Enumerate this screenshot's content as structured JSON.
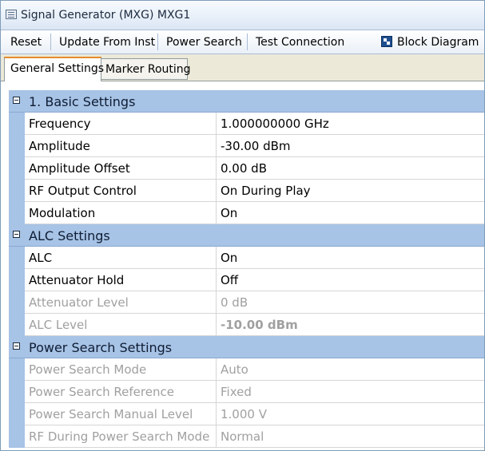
{
  "window": {
    "title": "Signal Generator (MXG) MXG1"
  },
  "toolbar": {
    "reset": "Reset",
    "update": "Update From Inst",
    "power_search": "Power Search",
    "test_connection": "Test Connection",
    "block_diagram": "Block Diagram"
  },
  "tabs": [
    "General Settings",
    "Marker Routing"
  ],
  "sections": [
    {
      "title": "1. Basic Settings",
      "rows": [
        {
          "name": "Frequency",
          "value": "1.000000000 GHz"
        },
        {
          "name": "Amplitude",
          "value": "-30.00 dBm"
        },
        {
          "name": "Amplitude Offset",
          "value": "0.00 dB"
        },
        {
          "name": "RF Output Control",
          "value": "On During Play"
        },
        {
          "name": "Modulation",
          "value": "On"
        }
      ]
    },
    {
      "title": "ALC Settings",
      "rows": [
        {
          "name": "ALC",
          "value": "On"
        },
        {
          "name": "Attenuator Hold",
          "value": "Off"
        },
        {
          "name": "Attenuator Level",
          "value": "0 dB"
        },
        {
          "name": "ALC Level",
          "value": "-10.00 dBm"
        }
      ]
    },
    {
      "title": "Power Search Settings",
      "rows": [
        {
          "name": "Power Search Mode",
          "value": "Auto"
        },
        {
          "name": "Power Search Reference",
          "value": "Fixed"
        },
        {
          "name": "Power Search Manual Level",
          "value": "1.000 V"
        },
        {
          "name": "RF During Power Search Mode",
          "value": "Normal"
        }
      ]
    }
  ]
}
